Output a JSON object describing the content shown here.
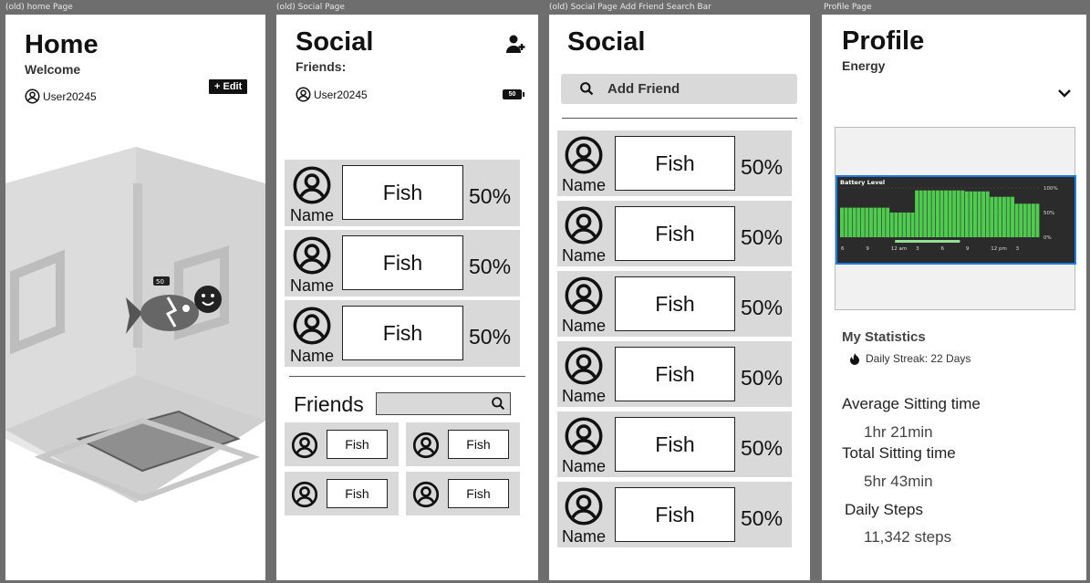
{
  "frames": {
    "home": {
      "label": "(old) home Page",
      "title": "Home",
      "subtitle": "Welcome",
      "username": "User20245",
      "edit_label": "+ Edit",
      "battery": "50"
    },
    "social": {
      "label": "(old) Social Page",
      "title": "Social",
      "subtitle": "Friends:",
      "username": "User20245",
      "battery": "50",
      "friends": [
        {
          "name": "Name",
          "pet": "Fish",
          "pct": "50%"
        },
        {
          "name": "Name",
          "pet": "Fish",
          "pct": "50%"
        },
        {
          "name": "Name",
          "pet": "Fish",
          "pct": "50%"
        }
      ],
      "friends_heading": "Friends",
      "grid": [
        {
          "pet": "Fish"
        },
        {
          "pet": "Fish"
        },
        {
          "pet": "Fish"
        },
        {
          "pet": "Fish"
        }
      ]
    },
    "social_search": {
      "label": "(old) Social Page Add Friend Search Bar",
      "title": "Social",
      "search_placeholder": "Add Friend",
      "friends": [
        {
          "name": "Name",
          "pet": "Fish",
          "pct": "50%"
        },
        {
          "name": "Name",
          "pet": "Fish",
          "pct": "50%"
        },
        {
          "name": "Name",
          "pet": "Fish",
          "pct": "50%"
        },
        {
          "name": "Name",
          "pet": "Fish",
          "pct": "50%"
        },
        {
          "name": "Name",
          "pet": "Fish",
          "pct": "50%"
        },
        {
          "name": "Name",
          "pet": "Fish",
          "pct": "50%"
        }
      ]
    },
    "profile": {
      "label": "Profile Page",
      "title": "Profile",
      "subtitle": "Energy",
      "chart_title": "Battery Level",
      "my_stats": "My Statistics",
      "streak": "Daily Streak: 22 Days",
      "stats": [
        {
          "label": "Average Sitting time",
          "value": "1hr 21min"
        },
        {
          "label": "Total Sitting time",
          "value": "5hr 43min"
        },
        {
          "label": "Daily Steps",
          "value": "11,342 steps"
        }
      ]
    }
  },
  "chart_data": {
    "type": "bar",
    "title": "Battery Level",
    "categories": [
      "6",
      "9",
      "12 am",
      "3",
      "6",
      "9",
      "12 pm",
      "3"
    ],
    "yticks": [
      "100%",
      "50%",
      "0%"
    ],
    "ylim": [
      0,
      100
    ],
    "values": [
      60,
      60,
      50,
      95,
      95,
      93,
      82,
      68
    ],
    "bar_color": "#4fcb4f"
  },
  "colors": {
    "card": "#d9d9d9",
    "chart_bg": "#2b2b2b",
    "chart_border": "#1e7be0"
  }
}
